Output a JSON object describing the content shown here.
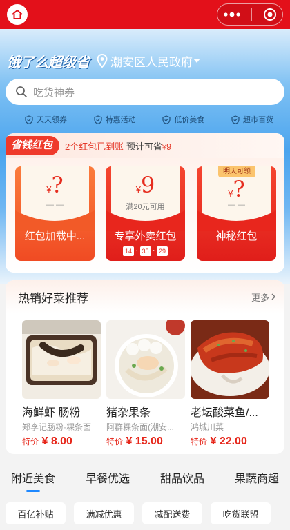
{
  "header": {
    "brand": "饿了么超级省",
    "location": "潮安区人民政府"
  },
  "search": {
    "placeholder": "吃货神券"
  },
  "badges": [
    {
      "label": "天天领券",
      "icon": "shield-check-icon"
    },
    {
      "label": "特惠活动",
      "icon": "shield-check-icon"
    },
    {
      "label": "低价美食",
      "icon": "shield-check-icon"
    },
    {
      "label": "超市百货",
      "icon": "shield-check-icon"
    }
  ],
  "redpacket": {
    "tag": "省钱红包",
    "message_prefix": "2个红包已到账",
    "message_mid": " 预计可省",
    "message_currency": "¥",
    "message_amount": "9",
    "envelopes": [
      {
        "currency": "¥",
        "amount": "?",
        "dash": "— —",
        "label": "红包加载中..."
      },
      {
        "currency": "¥",
        "amount": "9",
        "sub": "满20元可用",
        "label": "专享外卖红包",
        "timer": [
          "14",
          "35",
          "29"
        ]
      },
      {
        "tomorrow": "明天可领",
        "currency": "¥",
        "amount": "?",
        "dash": "— —",
        "label": "神秘红包"
      }
    ]
  },
  "hot": {
    "title": "热销好菜推荐",
    "more": "更多",
    "dishes": [
      {
        "name": "海鲜虾 肠粉",
        "shop": "郑李记肠粉·粿条面",
        "price_label": "特价",
        "price": "¥ 8.00"
      },
      {
        "name": "猪杂果条",
        "shop": "阿群粿条面(潮安...",
        "price_label": "特价",
        "price": "¥ 15.00"
      },
      {
        "name": "老坛酸菜鱼/...",
        "shop": "鸿城川菜",
        "price_label": "特价",
        "price": "¥ 22.00"
      }
    ]
  },
  "tabs": [
    "附近美食",
    "早餐优选",
    "甜品饮品",
    "果蔬商超"
  ],
  "chips": [
    "百亿补贴",
    "满减优惠",
    "减配送费",
    "吃货联盟"
  ],
  "colors": {
    "brand_red": "#e3101a",
    "accent_blue": "#1e88ff",
    "price_red": "#e6261a"
  }
}
